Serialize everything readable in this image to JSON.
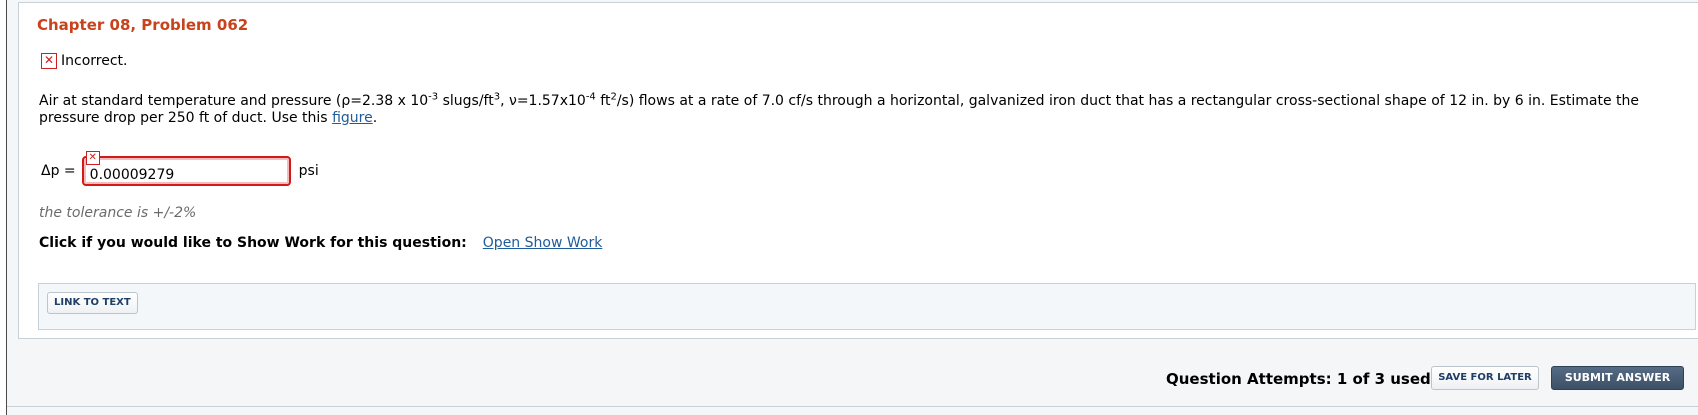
{
  "problem": {
    "title": "Chapter 08, Problem 062",
    "status_text": "Incorrect.",
    "status_icon": "incorrect-x-icon",
    "text_segments": {
      "s1": "Air at standard temperature and pressure (ρ=2.38 x 10",
      "sup1": "-3",
      "s2": " slugs/ft",
      "sup2": "3",
      "s3": ", ν=1.57x10",
      "sup3": "-4",
      "s4": " ft",
      "sup4": "2",
      "s5": "/s) flows at a rate of 7.0 cf/s through a horizontal, galvanized iron duct that has a rectangular cross-sectional shape of 12 in. by 6 in. Estimate the pressure drop per 250 ft of duct. Use this ",
      "link": "figure",
      "s6": "."
    }
  },
  "answer": {
    "label": "Δp =",
    "value": "0.00009279",
    "unit": "psi",
    "tolerance": "the tolerance is +/-2%"
  },
  "show_work": {
    "prompt": "Click if you would like to Show Work for this question:",
    "link": "Open Show Work"
  },
  "links_bar": {
    "link_to_text": "LINK TO TEXT"
  },
  "footer": {
    "attempts": "Question Attempts: 1 of 3 used",
    "save_label": "SAVE FOR LATER",
    "submit_label": "SUBMIT ANSWER"
  },
  "colors": {
    "title": "#c8421c",
    "error_red": "#d11a1a",
    "link_blue": "#1f5c99",
    "submit_bg": "#3c5068"
  }
}
